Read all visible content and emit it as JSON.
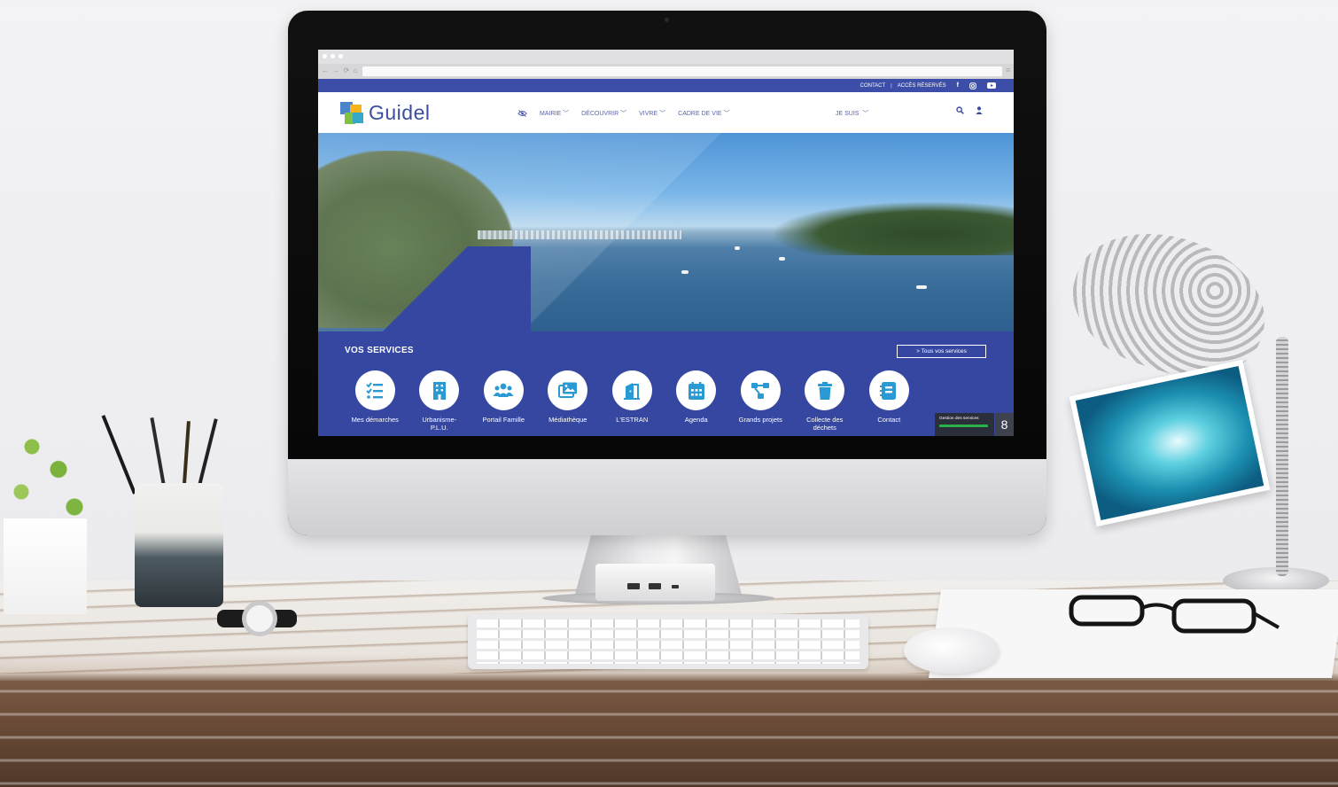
{
  "browser": {
    "nav_glyphs": "← → ⟳ ⌂",
    "menu_glyph": "≡"
  },
  "topbar": {
    "contact": "CONTACT",
    "separator": "|",
    "acces_reserves": "ACCÈS RÉSERVÉS",
    "social_icons": [
      "facebook-icon",
      "instagram-icon",
      "youtube-icon"
    ]
  },
  "header": {
    "logo_text": "Guidel",
    "nav": [
      {
        "label": "MAIRIE"
      },
      {
        "label": "DÉCOUVRIR"
      },
      {
        "label": "VIVRE"
      },
      {
        "label": "CADRE DE VIE"
      }
    ],
    "je_suis": "JE SUIS",
    "icons": [
      "accessibility-eye-icon",
      "search-icon",
      "user-icon"
    ]
  },
  "services": {
    "title": "VOS SERVICES",
    "all_link": "> Tous vos services",
    "items": [
      {
        "label": "Mes démarches",
        "icon": "checklist-icon"
      },
      {
        "label": "Urbanisme-\nP.L.U.",
        "icon": "building-icon"
      },
      {
        "label": "Portail Famille",
        "icon": "family-icon"
      },
      {
        "label": "Médiathèque",
        "icon": "images-icon"
      },
      {
        "label": "L'ESTRAN",
        "icon": "door-icon"
      },
      {
        "label": "Agenda",
        "icon": "calendar-icon"
      },
      {
        "label": "Grands projets",
        "icon": "project-diagram-icon"
      },
      {
        "label": "Collecte des\ndéchets",
        "icon": "trash-icon"
      },
      {
        "label": "Contact",
        "icon": "address-book-icon"
      }
    ],
    "gestion": {
      "label": "Gestion des services",
      "count": "8"
    }
  },
  "colors": {
    "brand": "#3b4da0",
    "services_bg": "#3547a0",
    "icon_blue": "#2a9ad4",
    "progress_green": "#2bb34a"
  }
}
